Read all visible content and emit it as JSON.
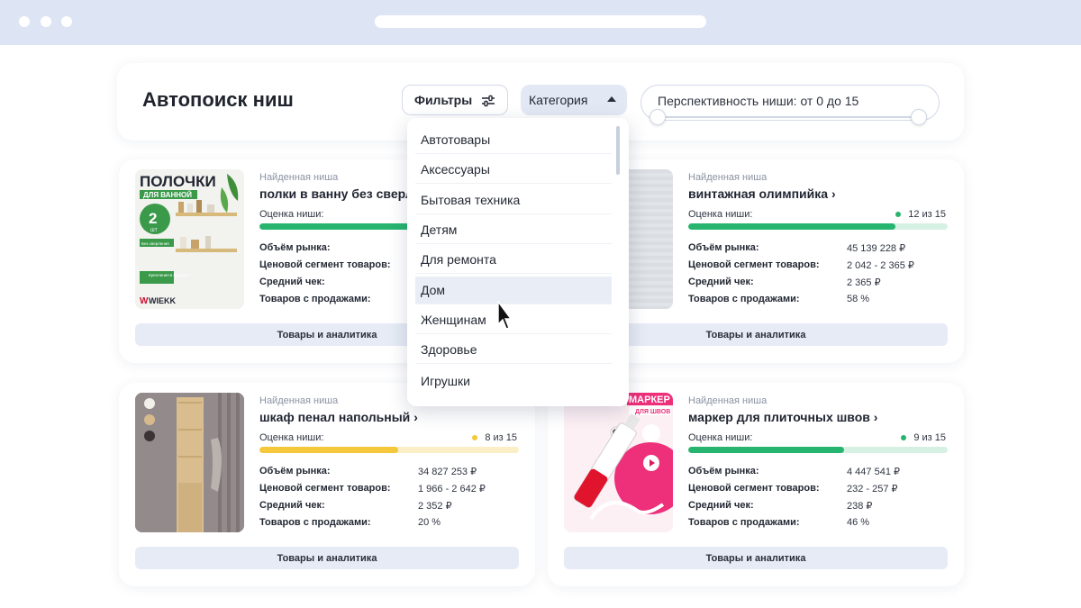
{
  "page": {
    "title": "Автопоиск ниш"
  },
  "toolbar": {
    "filters_label": "Фильтры",
    "category_label": "Категория",
    "range_label": "Перспективность ниши: от 0 до 15",
    "range": {
      "min": 0,
      "max": 15,
      "selected_min": 0,
      "selected_max": 15
    }
  },
  "dropdown": {
    "items": [
      "Автотовары",
      "Аксессуары",
      "Бытовая техника",
      "Детям",
      "Для ремонта",
      "Дом",
      "Женщинам",
      "Здоровье",
      "Игрушки"
    ],
    "hovered": "Дом"
  },
  "labels": {
    "found": "Найденная ниша",
    "rating": "Оценка ниши:",
    "market_volume": "Объём рынка:",
    "price_segment": "Ценовой сегмент товаров:",
    "avg_check": "Средний чек:",
    "with_sales": "Товаров с продажами:",
    "button": "Товары и аналитика"
  },
  "cards": [
    {
      "name": "полки в ванну без сверл",
      "score": 12,
      "score_max": 15,
      "score_text": "",
      "color": "#27b46f",
      "track": "#d6f1e3",
      "market_volume": "",
      "price_segment": "",
      "avg_check": "",
      "with_sales": "",
      "image": {
        "title": "ПОЛОЧКИ",
        "subtitle": "ДЛЯ ВАННОЙ",
        "badge_number": "2",
        "badge_unit": "ШТ",
        "note1": "Без сверления",
        "note2": "Крепления в подарок",
        "brand": "WIEKK"
      }
    },
    {
      "name": "винтажная олимпийка",
      "score": 12,
      "score_max": 15,
      "score_text": "12 из 15",
      "color": "#27b46f",
      "track": "#d6f1e3",
      "market_volume": "45 139 228 ₽",
      "price_segment": "2 042 - 2 365 ₽",
      "avg_check": "2 365 ₽",
      "with_sales": "58 %"
    },
    {
      "name": "шкаф пенал напольный",
      "score": 8,
      "score_max": 15,
      "score_text": "8 из 15",
      "color": "#f5c73a",
      "track": "#fbefc8",
      "market_volume": "34 827 253 ₽",
      "price_segment": "1 966 - 2 642 ₽",
      "avg_check": "2 352 ₽",
      "with_sales": "20 %"
    },
    {
      "name": "маркер для плиточных швов",
      "score": 9,
      "score_max": 15,
      "score_text": "9 из 15",
      "color": "#27b46f",
      "track": "#d6f1e3",
      "market_volume": "4 447 541 ₽",
      "price_segment": "232 - 257 ₽",
      "avg_check": "238 ₽",
      "with_sales": "46 %",
      "image": {
        "title": "МАРКЕР",
        "subtitle": "ДЛЯ ШВОВ"
      }
    }
  ]
}
